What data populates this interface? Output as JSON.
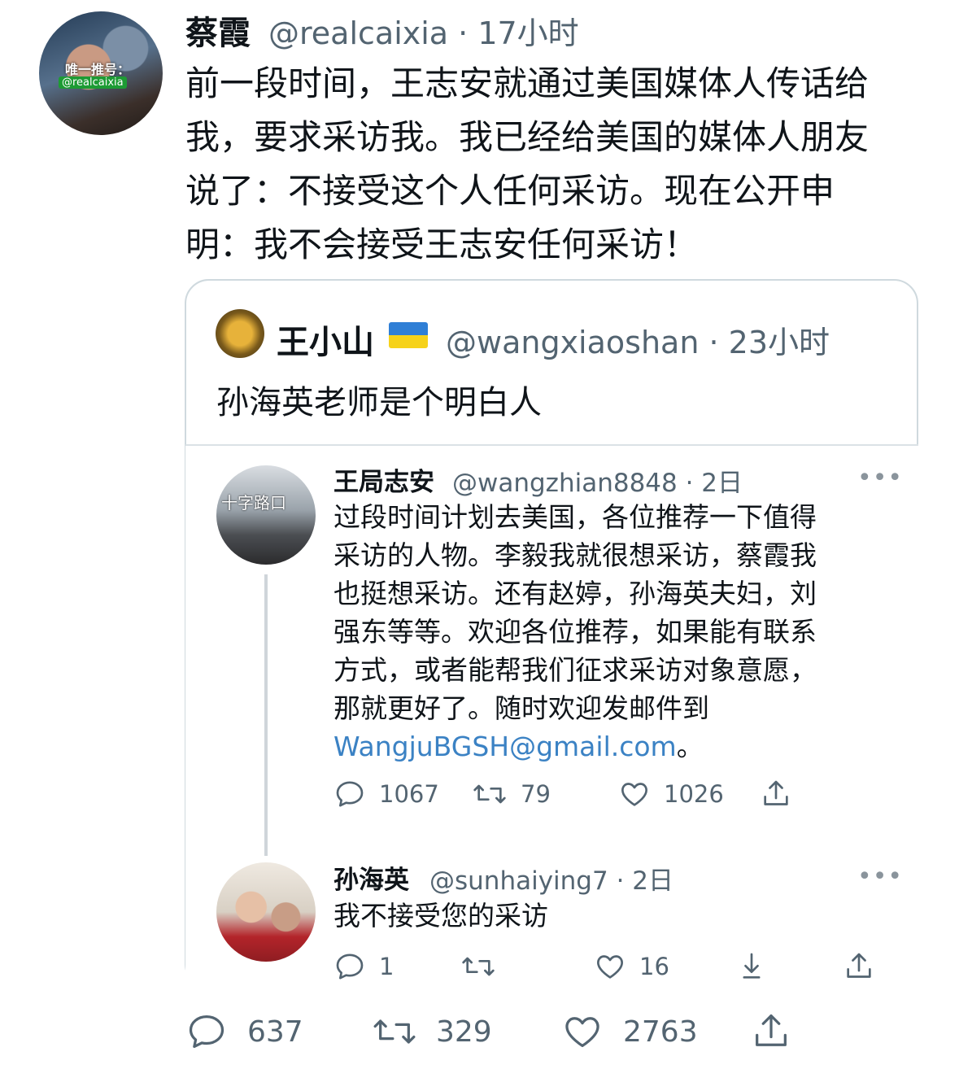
{
  "tweet": {
    "author_name": "蔡霞",
    "handle_time": "@realcaixia · 17小时",
    "avatar_watermark_line1": "唯一推号：",
    "avatar_watermark_line2": "@realcaixia",
    "text_lines": [
      "前一段时间，王志安就通过美国媒体人传话给",
      "我，要求采访我。我已经给美国的媒体人朋友",
      "说了：不接受这个人任何采访。现在公开申",
      "明：我不会接受王志安任何采访！"
    ],
    "stats": {
      "replies": "637",
      "retweets": "329",
      "likes": "2763"
    }
  },
  "quoted": {
    "author_name": "王小山",
    "handle_time": "@wangxiaoshan · 23小时",
    "text": "孙海英老师是个明白人"
  },
  "embedded": {
    "post1": {
      "author_name": "王局志安",
      "handle_time": "@wangzhian8848 · 2日",
      "avatar_caption": "十字路口",
      "text_lines": [
        "过段时间计划去美国，各位推荐一下值得",
        "采访的人物。李毅我就很想采访，蔡霞我",
        "也挺想采访。还有赵婷，孙海英夫妇，刘",
        "强东等等。欢迎各位推荐，如果能有联系",
        "方式，或者能帮我们征求采访对象意愿，",
        "那就更好了。随时欢迎发邮件到"
      ],
      "email": "WangjuBGSH@gmail.com",
      "email_suffix": "。",
      "more": "•••",
      "stats": {
        "replies": "1067",
        "retweets": "79",
        "likes": "1026"
      }
    },
    "post2": {
      "author_name": "孙海英",
      "handle_time": "@sunhaiying7 · 2日",
      "text": "我不接受您的采访",
      "more": "•••",
      "stats": {
        "replies": "1",
        "likes": "16"
      }
    }
  },
  "icons": [
    "reply-icon",
    "retweet-icon",
    "like-icon",
    "share-icon",
    "download-icon",
    "more-icon"
  ],
  "colors": {
    "text": "#0f1419",
    "muted": "#536471",
    "link": "#3b82c4",
    "border": "#cfd9de"
  }
}
